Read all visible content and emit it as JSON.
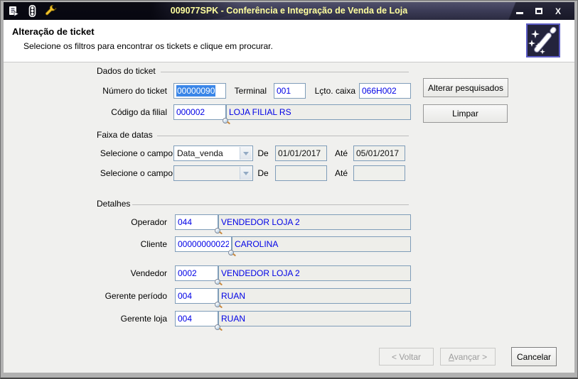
{
  "window": {
    "title": "009077SPK - Conferência e Integração de Venda de Loja"
  },
  "icons": {
    "close_glyph": "X"
  },
  "header": {
    "title": "Alteração de ticket",
    "subtitle": "Selecione os filtros para encontrar os tickets e clique em procurar."
  },
  "groups": {
    "dados": {
      "title": "Dados do ticket",
      "numero_label": "Número do ticket",
      "numero_value": "00000090",
      "terminal_label": "Terminal",
      "terminal_value": "001",
      "lcto_label": "Lçto. caixa",
      "lcto_value": "066H002",
      "filial_label": "Código da filial",
      "filial_code": "000002",
      "filial_name": "LOJA FILIAL RS"
    },
    "faixa": {
      "title": "Faixa de datas",
      "rows": [
        {
          "label": "Selecione o campo",
          "field": "Data_venda",
          "de_label": "De",
          "de_value": "01/01/2017",
          "ate_label": "Até",
          "ate_value": "05/01/2017"
        },
        {
          "label": "Selecione o campo",
          "field": "",
          "de_label": "De",
          "de_value": "",
          "ate_label": "Até",
          "ate_value": ""
        }
      ]
    },
    "detalhes": {
      "title": "Detalhes",
      "rows": [
        {
          "label": "Operador",
          "code": "044",
          "name": "VENDEDOR LOJA 2"
        },
        {
          "label": "Cliente",
          "code": "00000000022",
          "name": "CAROLINA"
        },
        {
          "label": "Vendedor",
          "code": "0002",
          "name": "VENDEDOR LOJA 2"
        },
        {
          "label": "Gerente período",
          "code": "004",
          "name": "RUAN"
        },
        {
          "label": "Gerente loja",
          "code": "004",
          "name": "RUAN"
        }
      ]
    }
  },
  "side_buttons": {
    "alterar": "Alterar pesquisados",
    "limpar": "Limpar"
  },
  "footer_buttons": {
    "voltar": "< Voltar",
    "avancar_mnemonic": "A",
    "avancar_rest": "vançar >",
    "cancelar": "Cancelar"
  },
  "colors": {
    "titlebar": "#3d3d58",
    "title_text": "#ffff9e",
    "field_text_blue": "#0000e6",
    "selection_bg": "#3a86e8",
    "content_bg": "#f0f0ee"
  }
}
